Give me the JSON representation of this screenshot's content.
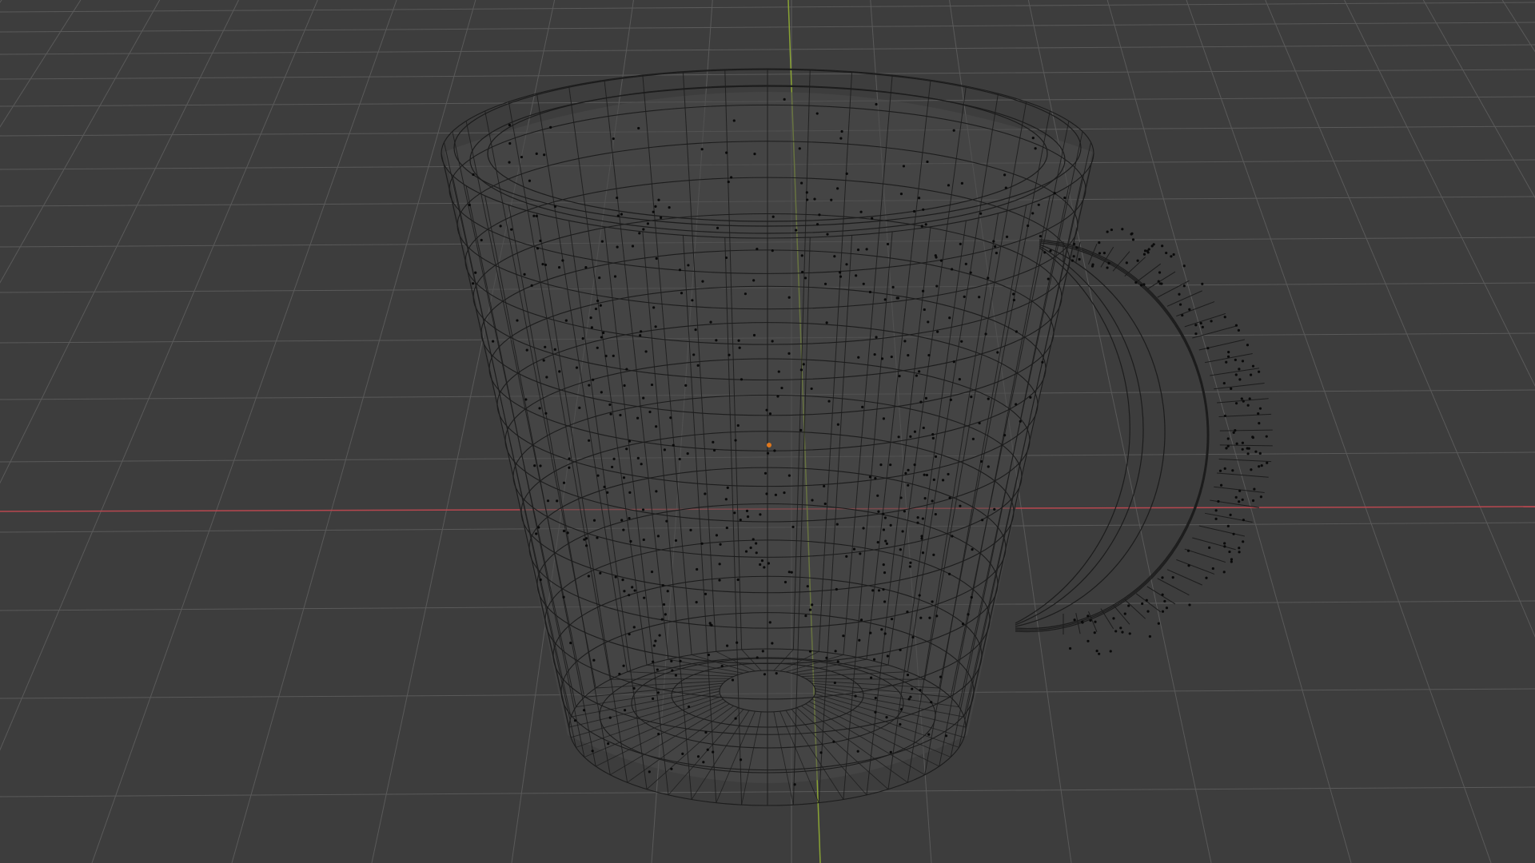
{
  "viewport": {
    "background": "#3d3d3d",
    "grid_color": "#5a5a5a",
    "x_axis_color": "#b8474f",
    "y_axis_color": "#8aa434",
    "mesh_edge_color": "#1c1c1c",
    "mesh_vertex_color": "#0a0a0a",
    "origin_color": "#e0781d",
    "shading": "wireframe"
  },
  "scene": {
    "object": "mug",
    "mode": "edit",
    "visible_elements": [
      "grid-floor",
      "x-axis-line",
      "y-axis-line",
      "mug-wireframe",
      "object-origin"
    ]
  }
}
